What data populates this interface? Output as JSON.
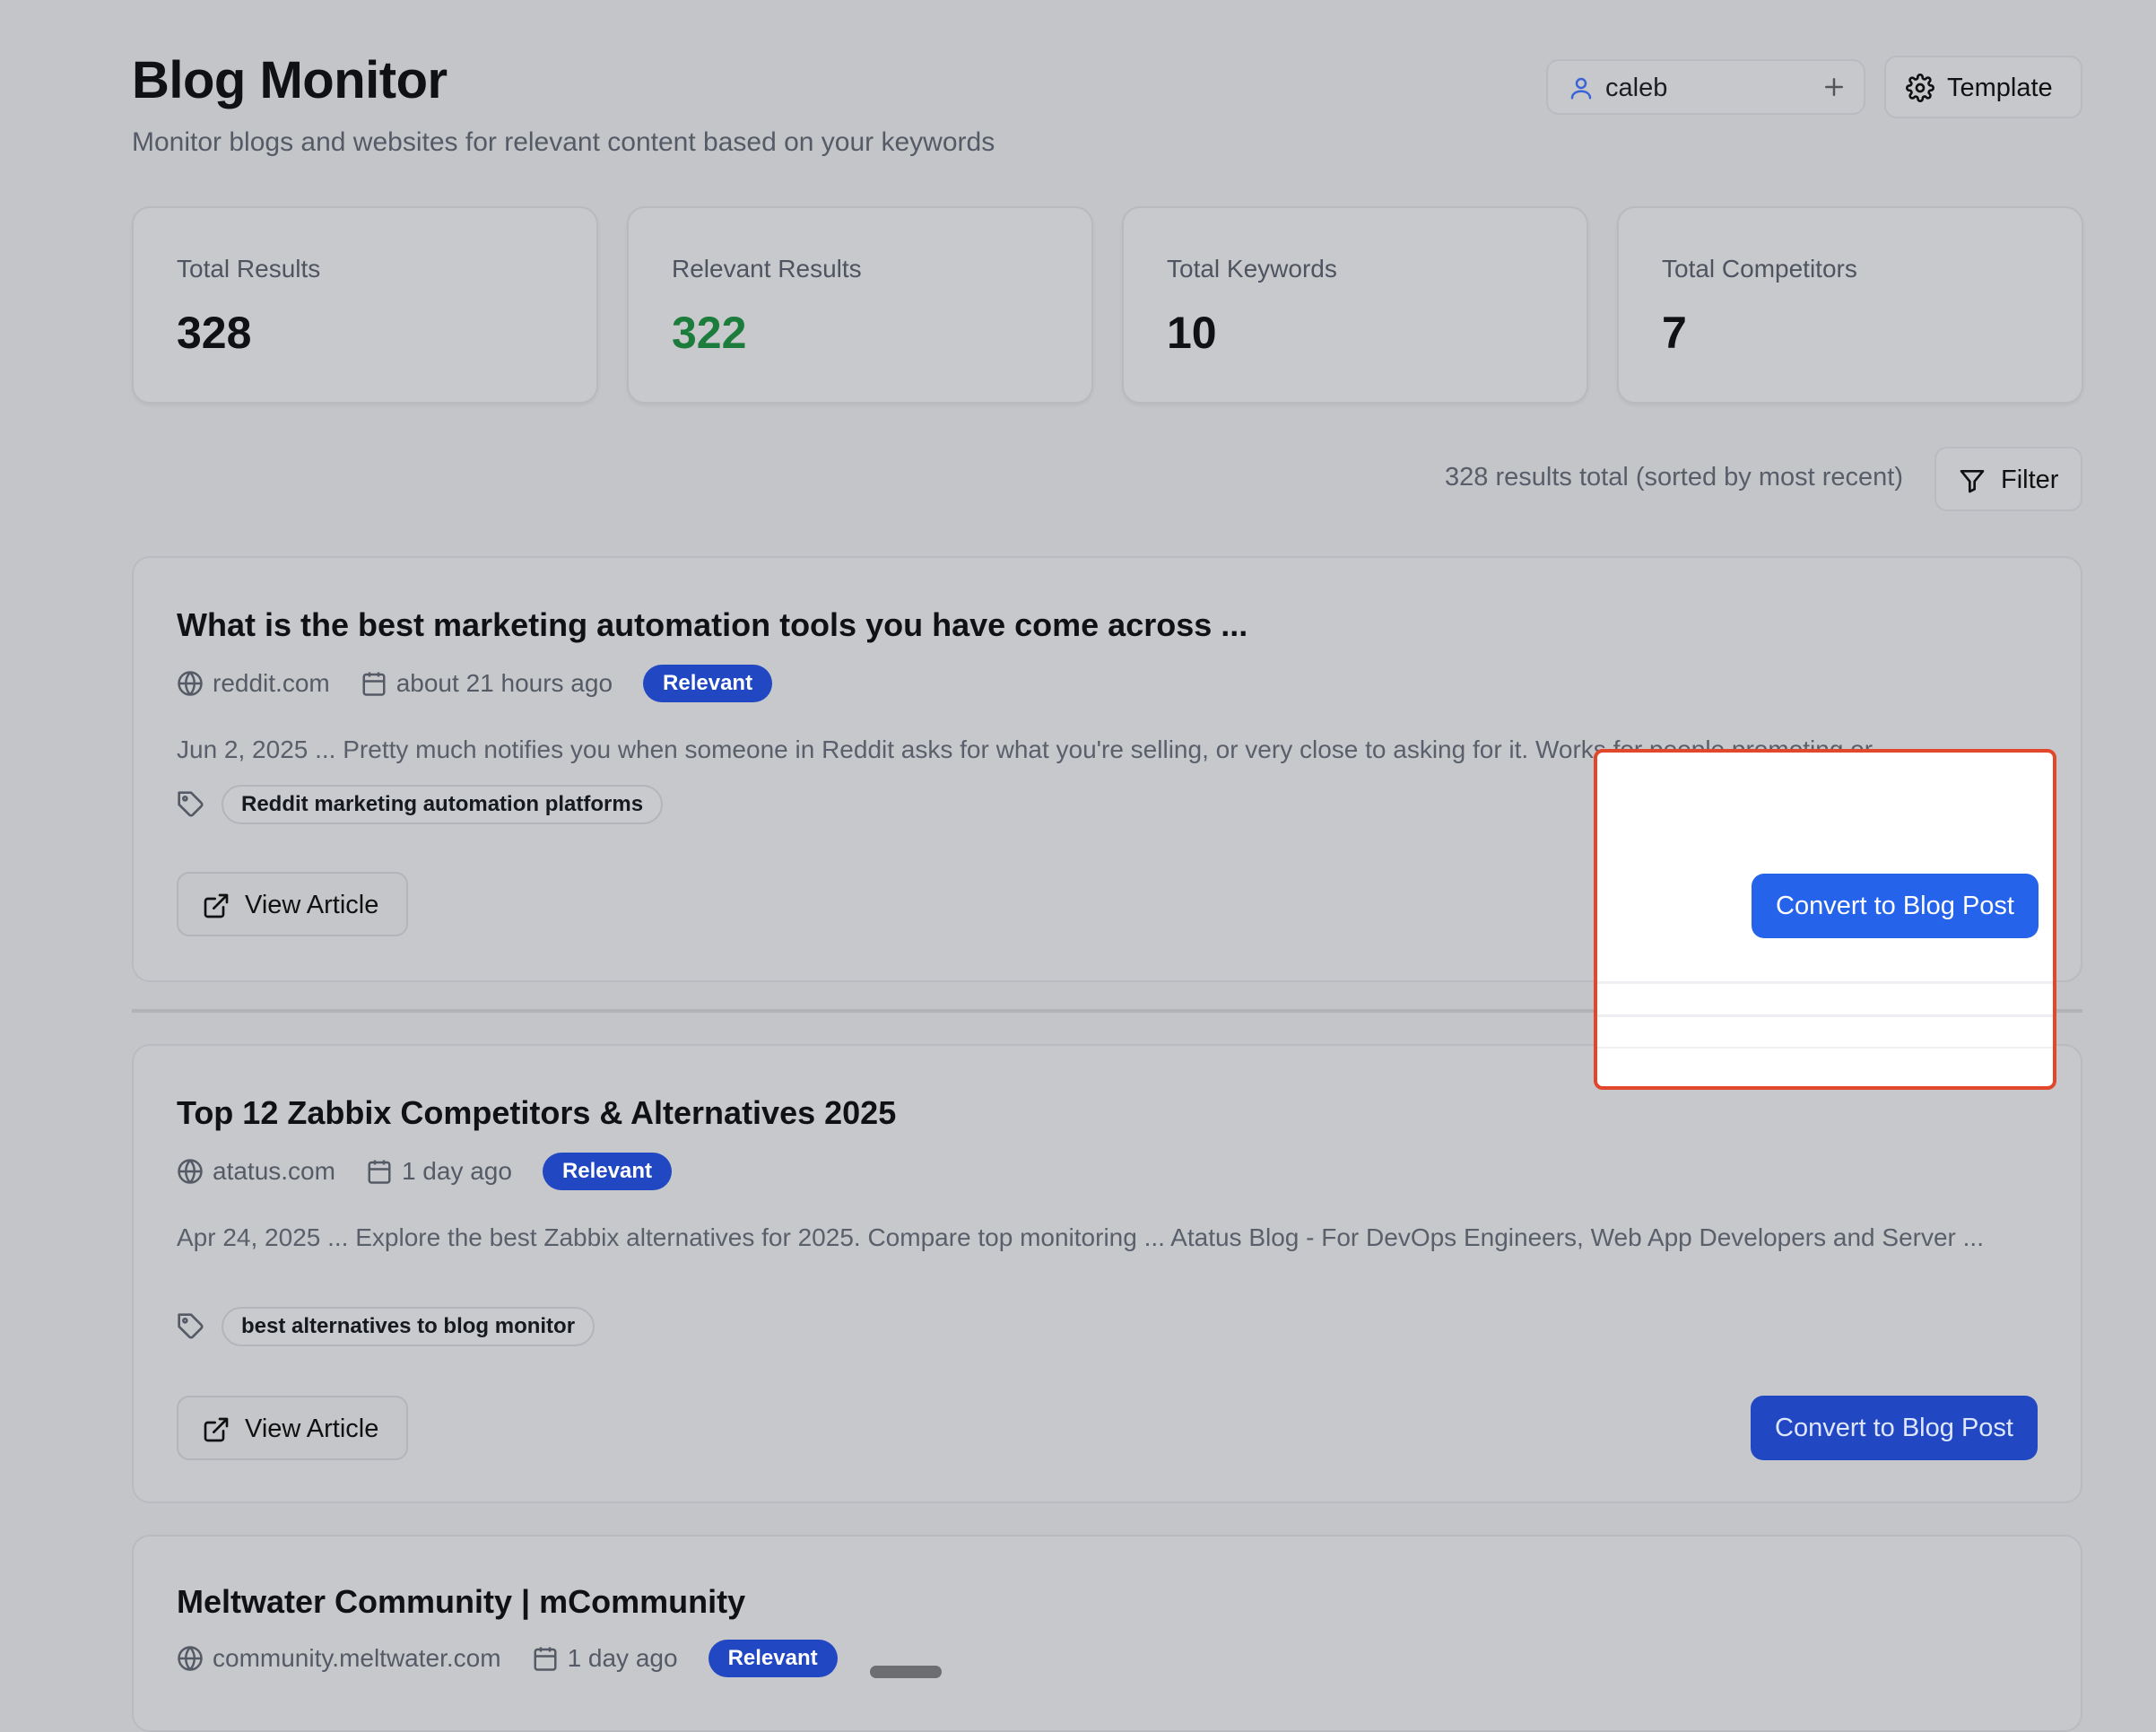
{
  "header": {
    "title": "Blog Monitor",
    "subtitle": "Monitor blogs and websites for relevant content based on your keywords",
    "user": "caleb",
    "template_label": "Template"
  },
  "stats": [
    {
      "label": "Total Results",
      "value": "328"
    },
    {
      "label": "Relevant Results",
      "value": "322"
    },
    {
      "label": "Total Keywords",
      "value": "10"
    },
    {
      "label": "Total Competitors",
      "value": "7"
    }
  ],
  "toolbar": {
    "summary": "328 results total (sorted by most recent)",
    "filter_label": "Filter"
  },
  "results": [
    {
      "title": "What is the best marketing automation tools you have come across ...",
      "source": "reddit.com",
      "time": "about 21 hours ago",
      "badge": "Relevant",
      "snippet": "Jun 2, 2025 ... Pretty much notifies you when someone in Reddit asks for what you're selling, or very close to asking for it. Works for people promoting or ...",
      "tag": "Reddit marketing automation platforms",
      "view_label": "View Article",
      "convert_label": "Convert to Blog Post"
    },
    {
      "title": "Top 12 Zabbix Competitors & Alternatives 2025",
      "source": "atatus.com",
      "time": "1 day ago",
      "badge": "Relevant",
      "snippet": "Apr 24, 2025 ... Explore the best Zabbix alternatives for 2025. Compare top monitoring ... Atatus Blog - For DevOps Engineers, Web App Developers and Server ...",
      "tag": "best alternatives to blog monitor",
      "view_label": "View Article",
      "convert_label": "Convert to Blog Post"
    },
    {
      "title": "Meltwater Community | mCommunity",
      "source": "community.meltwater.com",
      "time": "1 day ago",
      "badge": "Relevant"
    }
  ],
  "colors": {
    "accent": "#2563eb",
    "badge": "#2148c2",
    "relevant_value": "#1c7c3c",
    "highlight_border": "#e2462b"
  }
}
